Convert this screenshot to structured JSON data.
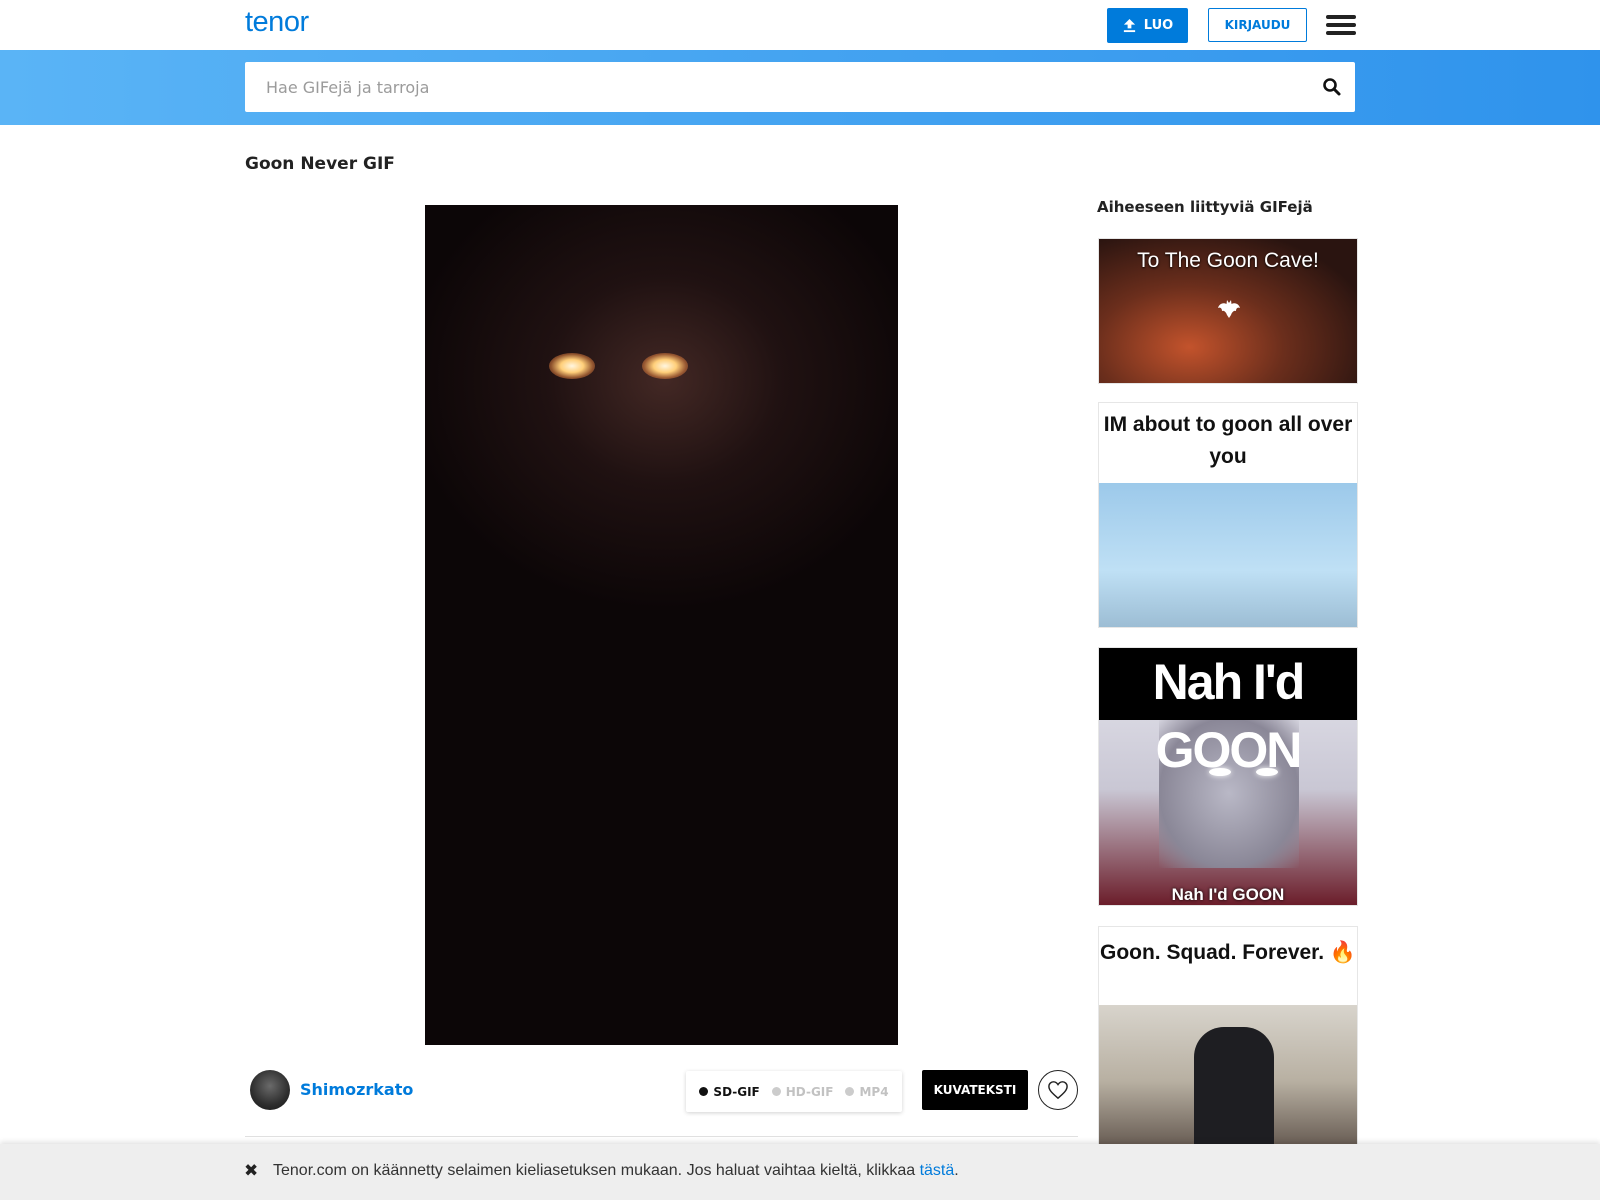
{
  "header": {
    "logo": "tenor",
    "create_label": "LUO",
    "login_label": "KIRJAUDU"
  },
  "search": {
    "placeholder": "Hae GIFejä ja tarroja",
    "value": ""
  },
  "main": {
    "title": "Goon Never GIF",
    "author": "Shimozrkato",
    "formats": [
      "SD-GIF",
      "HD-GIF",
      "MP4"
    ],
    "active_format": "SD-GIF",
    "caption_label": "KUVATEKSTI"
  },
  "sidebar": {
    "title": "Aiheeseen liittyviä GIFejä",
    "items": [
      {
        "caption": "To The Goon Cave!"
      },
      {
        "caption": "IM about to goon all over you"
      },
      {
        "caption": "Nah I'd GOON",
        "caption_bottom": "Nah I'd GOON"
      },
      {
        "caption": "Goon. Squad. Forever. 🔥"
      }
    ]
  },
  "language_bar": {
    "close_symbol": "✖",
    "text": "Tenor.com on käännetty selaimen kieliasetuksen mukaan. Jos haluat vaihtaa kieltä, klikkaa ",
    "link_text": "tästä",
    "suffix": "."
  },
  "colors": {
    "brand": "#007bdb",
    "search_band_start": "#5ab4f6",
    "search_band_end": "#2f93ec"
  },
  "icons": [
    "upload-icon",
    "menu-icon",
    "search-icon",
    "heart-icon",
    "close-icon"
  ]
}
